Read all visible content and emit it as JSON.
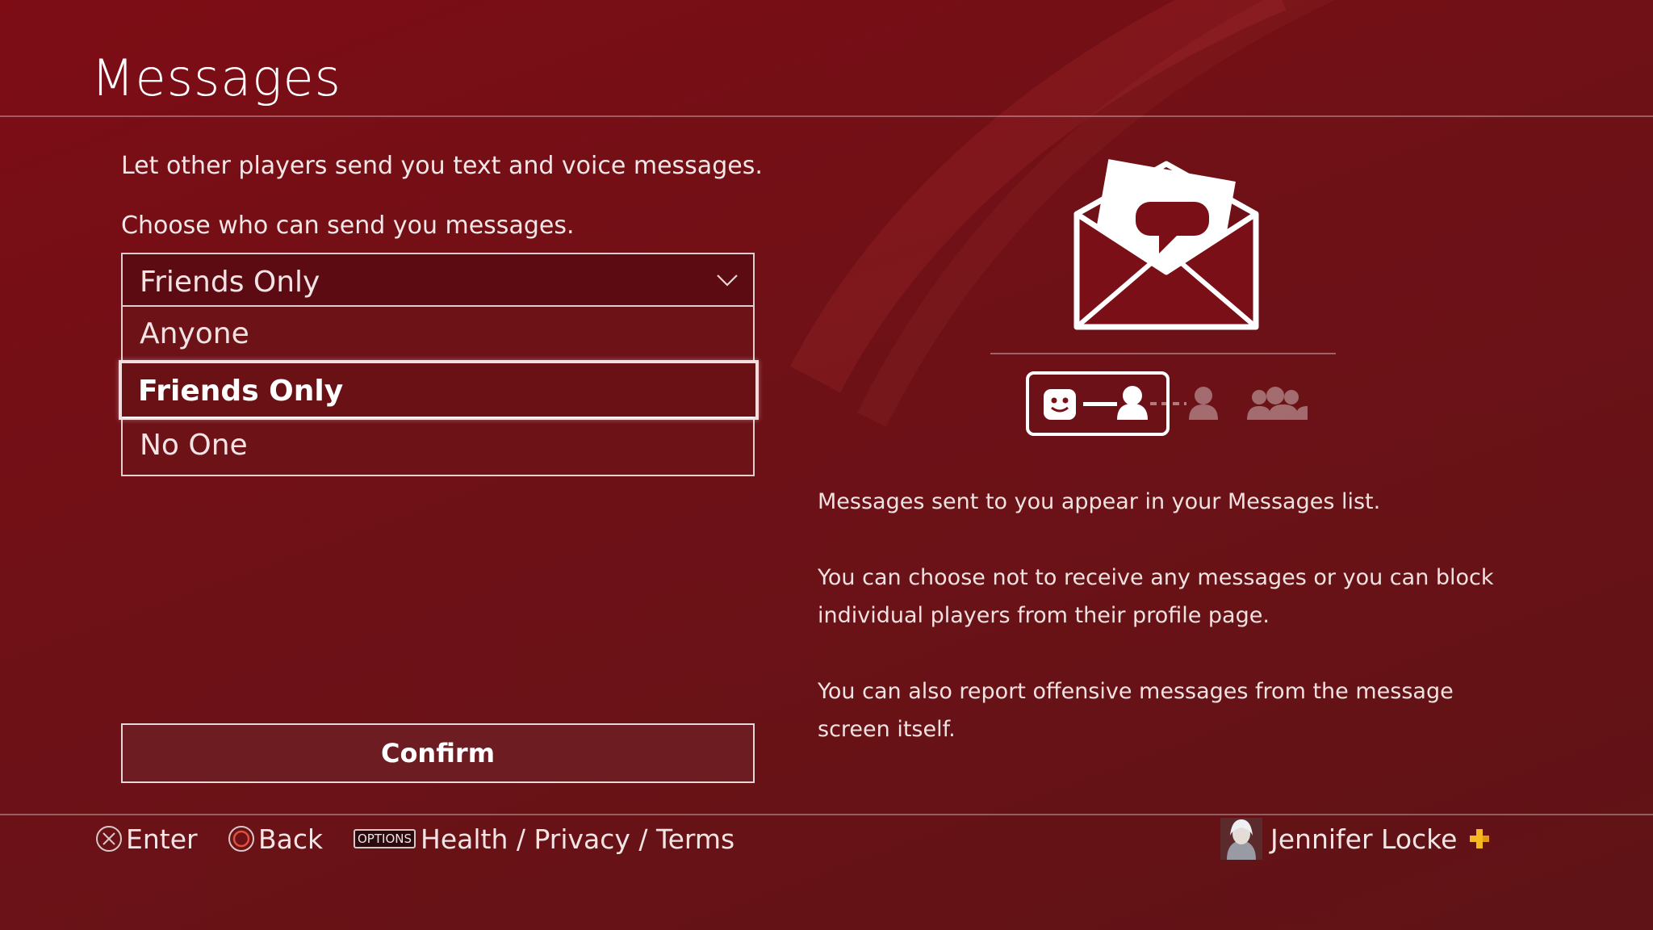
{
  "header": {
    "title": "Messages"
  },
  "main": {
    "intro": "Let other players send you text and voice messages.",
    "prompt": "Choose who can send you messages.",
    "select": {
      "value": "Friends Only",
      "options": [
        {
          "label": "Anyone"
        },
        {
          "label": "Friends Only",
          "selected": true
        },
        {
          "label": "No One"
        }
      ]
    },
    "confirm_label": "Confirm"
  },
  "info": {
    "illustration_icon": "envelope-chat-icon",
    "privacy_scale_icons": [
      "friend-link-icon",
      "person-icon",
      "group-icon"
    ],
    "descriptions": [
      "Messages sent to you appear in your Messages list.",
      "You can choose not to receive any messages or you can block individual players from their profile page.",
      "You can also report offensive messages from the message screen itself."
    ]
  },
  "footer": {
    "enter_label": "Enter",
    "back_label": "Back",
    "options_chip": "OPTIONS",
    "options_label": "Health / Privacy / Terms",
    "user_name": "Jennifer Locke"
  },
  "colors": {
    "background": "#7a0f17",
    "plus_gold": "#f5b81e",
    "text": "#f5e9e9"
  }
}
